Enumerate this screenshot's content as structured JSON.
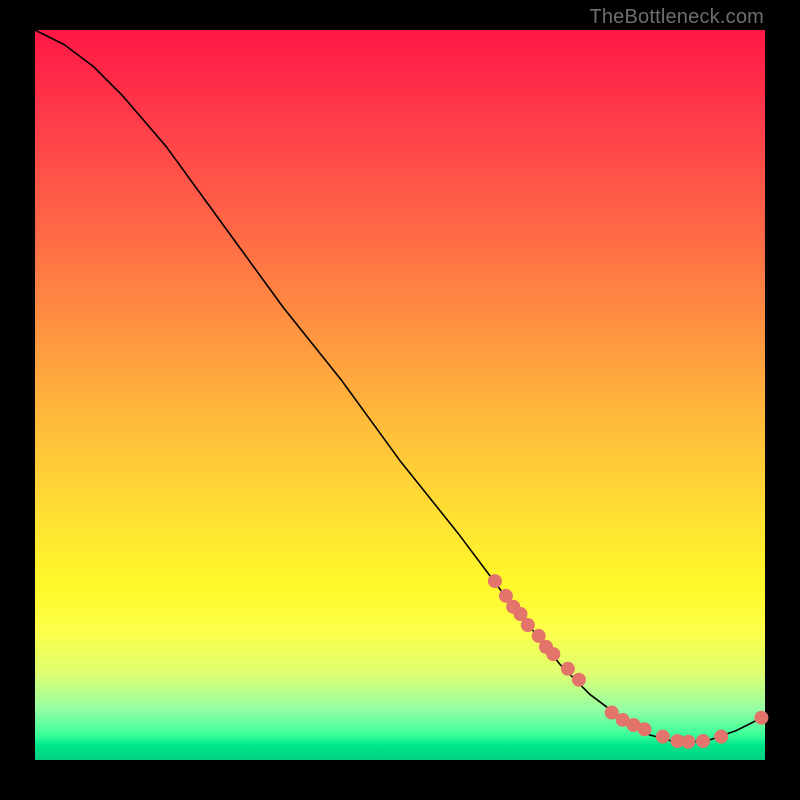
{
  "watermark": "TheBottleneck.com",
  "colors": {
    "background": "#000000",
    "curve": "#000000",
    "dot": "#e2746b",
    "gradient_top": "#ff1746",
    "gradient_bottom": "#00d080"
  },
  "chart_data": {
    "type": "line",
    "title": "",
    "xlabel": "",
    "ylabel": "",
    "xlim": [
      0,
      100
    ],
    "ylim": [
      0,
      100
    ],
    "grid": false,
    "legend": false,
    "_note": "Axes are unlabeled in the image; x and y are normalized to the plot area (0–100). The curve descends from upper-left, reaches a minimum near x≈88, then rises slightly. Dots are concentrated along the lower-right portion of the curve.",
    "series": [
      {
        "name": "curve",
        "type": "line",
        "x": [
          0,
          4,
          8,
          12,
          18,
          26,
          34,
          42,
          50,
          58,
          64,
          68,
          72,
          76,
          80,
          84,
          88,
          92,
          96,
          100
        ],
        "y": [
          100,
          98,
          95,
          91,
          84,
          73,
          62,
          52,
          41,
          31,
          23,
          18,
          13,
          9,
          6,
          3.5,
          2.4,
          2.6,
          4,
          6
        ]
      },
      {
        "name": "dots",
        "type": "scatter",
        "x": [
          63,
          64.5,
          65.5,
          66.5,
          67.5,
          69,
          70,
          71,
          73,
          74.5,
          79,
          80.5,
          82,
          83.5,
          86,
          88,
          89.5,
          91.5,
          94,
          99.5
        ],
        "y": [
          24.5,
          22.5,
          21,
          20,
          18.5,
          17,
          15.5,
          14.5,
          12.5,
          11,
          6.5,
          5.5,
          4.8,
          4.2,
          3.2,
          2.6,
          2.5,
          2.6,
          3.2,
          5.8
        ]
      }
    ]
  }
}
